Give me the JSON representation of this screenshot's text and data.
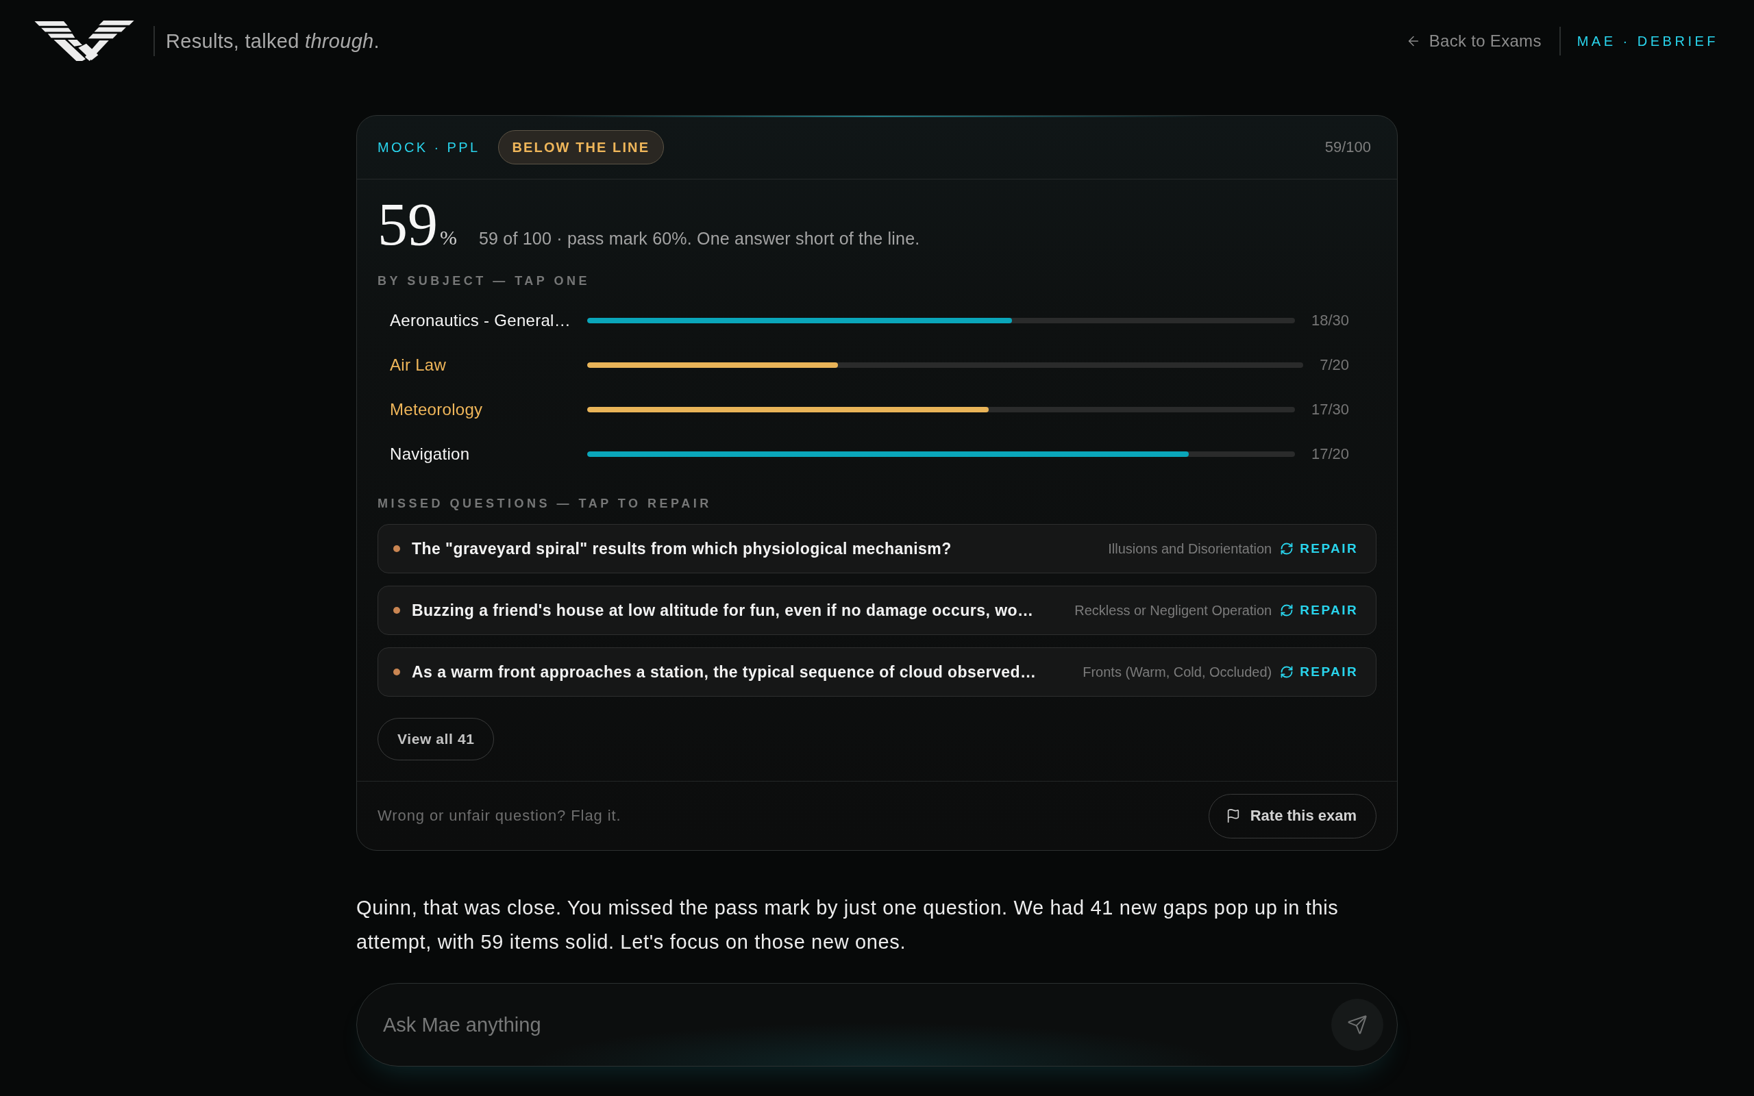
{
  "header": {
    "tagline": "Results, talked *through*.",
    "back_link": "Back to Exams",
    "section_label": "MAE · DEBRIEF"
  },
  "result_card": {
    "exam_label": "MOCK · PPL",
    "passed": false,
    "status_badge": "BELOW THE LINE",
    "score_total": "59/100",
    "score": "59",
    "score_unit": "%",
    "summary": "59 of 100 · pass mark 60%. One answer short of the line.",
    "subjects_heading": "BY SUBJECT — TAP ONE",
    "subjects": [
      {
        "name": "Aeronautics - General…",
        "level": 0.6,
        "score": "18/30",
        "below_pass": false
      },
      {
        "name": "Air Law",
        "level": 0.35,
        "score": "7/20",
        "below_pass": true
      },
      {
        "name": "Meteorology",
        "level": 0.567,
        "score": "17/30",
        "below_pass": true
      },
      {
        "name": "Navigation",
        "level": 0.85,
        "score": "17/20",
        "below_pass": false
      }
    ],
    "missed_heading": "MISSED QUESTIONS — TAP TO REPAIR",
    "missed_questions": [
      {
        "question": "The \"graveyard spiral\" results from which physiological mechanism?",
        "topic": "Illusions and Disorientation",
        "action": "REPAIR"
      },
      {
        "question": "Buzzing a friend's house at low altitude for fun, even if no damage occurs, wo…",
        "topic": "Reckless or Negligent Operation",
        "action": "REPAIR"
      },
      {
        "question": "As a warm front approaches a station, the typical sequence of cloud observed…",
        "topic": "Fronts (Warm, Cold, Occluded)",
        "action": "REPAIR"
      }
    ],
    "view_all_button": "View all 41",
    "flag_prompt": "Wrong or unfair question? Flag it.",
    "rate_button": "Rate this exam"
  },
  "message": "Quinn, that was close. You missed the pass mark by just one question. We had 41 new gaps pop up in this attempt, with 59 items solid. Let's focus on those new ones.",
  "chat_input": {
    "placeholder": "Ask Mae anything"
  }
}
